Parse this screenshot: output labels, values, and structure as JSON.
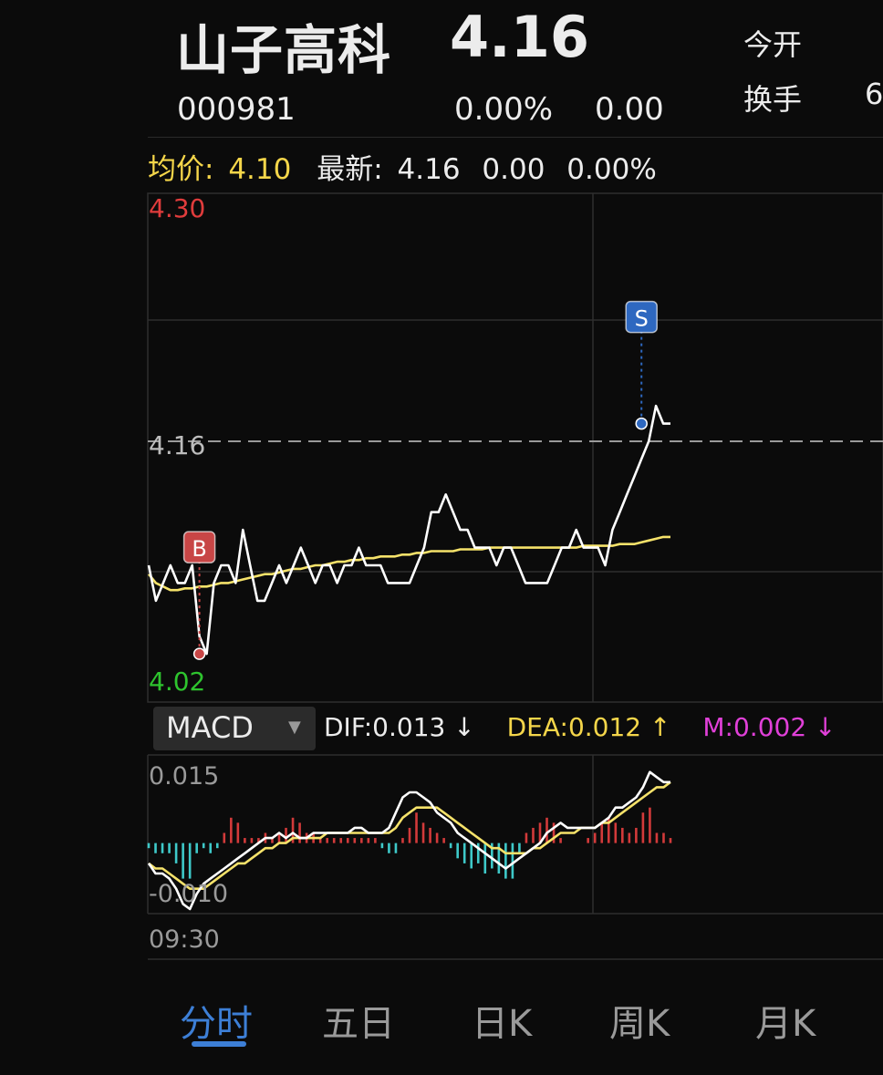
{
  "header": {
    "name": "山子高科",
    "price": "4.16",
    "code": "000981",
    "change_pct": "0.00%",
    "change": "0.00",
    "side_label_1": "今开",
    "side_label_2": "换手",
    "side_value_2": "6"
  },
  "info_bar": {
    "avg_label": "均价:",
    "avg_value": "4.10",
    "latest_label": "最新:",
    "latest_value": "4.16",
    "latest_change": "0.00",
    "latest_pct": "0.00%"
  },
  "price_axis": {
    "high": "4.30",
    "low": "4.02",
    "current": "4.16",
    "high_color": "#e03c3c",
    "low_color": "#2ec42e"
  },
  "markers": {
    "buy": "B",
    "sell": "S",
    "buy_color": "#c84646",
    "sell_color": "#2e68c0"
  },
  "macd": {
    "indicator": "MACD",
    "dif": "DIF:0.013 ↓",
    "dea": "DEA:0.012 ↑",
    "m": "M:0.002 ↓",
    "y_top": "0.015",
    "y_bottom": "-0.010"
  },
  "time_axis": {
    "start": "09:30"
  },
  "tabs": [
    {
      "label": "分时",
      "active": true
    },
    {
      "label": "五日",
      "active": false
    },
    {
      "label": "日K",
      "active": false
    },
    {
      "label": "周K",
      "active": false
    },
    {
      "label": "月K",
      "active": false
    }
  ],
  "chart_data": [
    {
      "type": "line",
      "ylim": [
        4.02,
        4.3
      ],
      "series": [
        {
          "name": "",
          "color": "#ffffff",
          "values": [
            4.09,
            4.07,
            4.08,
            4.09,
            4.08,
            4.08,
            4.09,
            4.05,
            4.04,
            4.08,
            4.09,
            4.09,
            4.08,
            4.11,
            4.09,
            4.07,
            4.07,
            4.08,
            4.09,
            4.08,
            4.09,
            4.1,
            4.09,
            4.08,
            4.09,
            4.09,
            4.08,
            4.09,
            4.09,
            4.1,
            4.09,
            4.09,
            4.09,
            4.08,
            4.08,
            4.08,
            4.08,
            4.09,
            4.1,
            4.12,
            4.12,
            4.13,
            4.12,
            4.11,
            4.11,
            4.1,
            4.1,
            4.1,
            4.09,
            4.1,
            4.1,
            4.09,
            4.08,
            4.08,
            4.08,
            4.08,
            4.09,
            4.1,
            4.1,
            4.11,
            4.1,
            4.1,
            4.1,
            4.09,
            4.11,
            4.12,
            4.13,
            4.14,
            4.15,
            4.16,
            4.18,
            4.17,
            4.17
          ]
        },
        {
          "name": "",
          "color": "#f5e26a",
          "values": [
            4.085,
            4.08,
            4.078,
            4.076,
            4.076,
            4.077,
            4.077,
            4.078,
            4.078,
            4.079,
            4.08,
            4.08,
            4.081,
            4.082,
            4.083,
            4.084,
            4.085,
            4.085,
            4.086,
            4.087,
            4.088,
            4.088,
            4.089,
            4.09,
            4.09,
            4.091,
            4.092,
            4.092,
            4.093,
            4.093,
            4.094,
            4.094,
            4.095,
            4.095,
            4.095,
            4.096,
            4.096,
            4.097,
            4.097,
            4.098,
            4.098,
            4.098,
            4.098,
            4.099,
            4.099,
            4.099,
            4.099,
            4.1,
            4.1,
            4.1,
            4.1,
            4.1,
            4.1,
            4.1,
            4.1,
            4.1,
            4.1,
            4.1,
            4.1,
            4.1,
            4.101,
            4.101,
            4.101,
            4.101,
            4.101,
            4.102,
            4.102,
            4.102,
            4.103,
            4.104,
            4.105,
            4.106,
            4.106
          ]
        }
      ],
      "annotations": [
        {
          "label": "B",
          "index": 7,
          "value": 4.04
        },
        {
          "label": "S",
          "index": 68,
          "value": 4.17
        }
      ],
      "reference_line": 4.16
    },
    {
      "type": "bar",
      "ylim": [
        -0.013,
        0.017
      ],
      "series": [
        {
          "name": "DIF",
          "color": "#ffffff",
          "values": [
            -0.004,
            -0.006,
            -0.006,
            -0.007,
            -0.009,
            -0.012,
            -0.013,
            -0.01,
            -0.008,
            -0.007,
            -0.006,
            -0.005,
            -0.004,
            -0.003,
            -0.002,
            -0.001,
            0.0,
            0.001,
            0.001,
            0.002,
            0.001,
            0.002,
            0.001,
            0.001,
            0.002,
            0.002,
            0.002,
            0.002,
            0.002,
            0.002,
            0.003,
            0.003,
            0.002,
            0.002,
            0.002,
            0.003,
            0.006,
            0.009,
            0.01,
            0.01,
            0.009,
            0.008,
            0.006,
            0.005,
            0.004,
            0.002,
            0.001,
            0.0,
            -0.001,
            -0.002,
            -0.003,
            -0.004,
            -0.005,
            -0.004,
            -0.003,
            -0.002,
            -0.001,
            0.0,
            0.002,
            0.003,
            0.004,
            0.003,
            0.003,
            0.003,
            0.003,
            0.003,
            0.004,
            0.005,
            0.007,
            0.007,
            0.008,
            0.009,
            0.011,
            0.014,
            0.013,
            0.012,
            0.012
          ]
        },
        {
          "name": "DEA",
          "color": "#f5e26a",
          "values": [
            -0.004,
            -0.005,
            -0.005,
            -0.006,
            -0.007,
            -0.008,
            -0.009,
            -0.009,
            -0.009,
            -0.008,
            -0.007,
            -0.006,
            -0.005,
            -0.004,
            -0.004,
            -0.003,
            -0.002,
            -0.001,
            -0.001,
            0.0,
            0.0,
            0.001,
            0.001,
            0.001,
            0.001,
            0.001,
            0.002,
            0.002,
            0.002,
            0.002,
            0.002,
            0.002,
            0.002,
            0.002,
            0.002,
            0.002,
            0.003,
            0.005,
            0.006,
            0.007,
            0.007,
            0.007,
            0.007,
            0.006,
            0.005,
            0.004,
            0.003,
            0.002,
            0.001,
            0.0,
            -0.001,
            -0.001,
            -0.002,
            -0.002,
            -0.002,
            -0.002,
            -0.001,
            -0.001,
            0.0,
            0.001,
            0.002,
            0.002,
            0.002,
            0.003,
            0.003,
            0.003,
            0.004,
            0.004,
            0.005,
            0.006,
            0.007,
            0.008,
            0.009,
            0.01,
            0.011,
            0.011,
            0.012
          ]
        },
        {
          "name": "M",
          "color": "#d23a3a",
          "values": [
            -0.001,
            -0.002,
            -0.002,
            -0.002,
            -0.004,
            -0.007,
            -0.007,
            -0.002,
            -0.001,
            -0.002,
            -0.001,
            0.002,
            0.005,
            0.004,
            0.001,
            0.001,
            0.001,
            0.002,
            0.001,
            0.002,
            0.003,
            0.005,
            0.004,
            0.002,
            0.002,
            0.001,
            0.001,
            0.001,
            0.001,
            0.001,
            0.001,
            0.001,
            0.001,
            0.001,
            -0.001,
            -0.002,
            -0.002,
            0.001,
            0.003,
            0.006,
            0.004,
            0.003,
            0.002,
            0.001,
            -0.001,
            -0.003,
            -0.004,
            -0.005,
            -0.004,
            -0.006,
            -0.005,
            -0.006,
            -0.007,
            -0.007,
            -0.002,
            0.002,
            0.003,
            0.004,
            0.005,
            0.004,
            0.001,
            0.0,
            0.0,
            0.0,
            0.001,
            0.002,
            0.004,
            0.005,
            0.004,
            0.003,
            0.002,
            0.003,
            0.006,
            0.007,
            0.002,
            0.002,
            0.001
          ]
        }
      ]
    }
  ]
}
